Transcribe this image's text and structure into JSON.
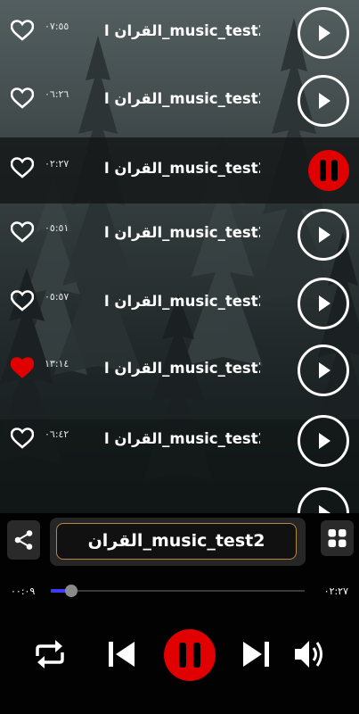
{
  "tracks": [
    {
      "title": "القران ا_music_test2",
      "duration": "٠٧:٥٥",
      "favorite": false,
      "state": "idle"
    },
    {
      "title": "القران ا_music_test2",
      "duration": "٠٦:٢٦",
      "favorite": false,
      "state": "idle"
    },
    {
      "title": "القران ا_music_test2",
      "duration": "٠٢:٢٧",
      "favorite": false,
      "state": "playing"
    },
    {
      "title": "القران ا_music_test2",
      "duration": "٠٥:٥١",
      "favorite": false,
      "state": "idle"
    },
    {
      "title": "القران ا_music_test2",
      "duration": "٠٥:٥٧",
      "favorite": false,
      "state": "idle"
    },
    {
      "title": "القران ا_music_test2",
      "duration": "١٣:١٤",
      "favorite": true,
      "state": "idle"
    },
    {
      "title": "القران ا_music_test2",
      "duration": "٠٦:٤٢",
      "favorite": false,
      "state": "idle"
    }
  ],
  "player": {
    "now_playing_title": "القران_music_test2",
    "time_elapsed": "٠٠:٠٩",
    "time_total": "٠٢:٢٧",
    "progress_fraction": 0.06,
    "is_playing": true
  },
  "icons": {
    "share": "share-icon",
    "grid": "grid-icon",
    "repeat": "repeat-icon",
    "previous": "skip-previous-icon",
    "pause": "pause-icon",
    "next": "skip-next-icon",
    "volume": "volume-icon",
    "play": "play-icon",
    "heart": "heart-icon"
  },
  "colors": {
    "accent_red": "#e00000",
    "favorite_red": "#e00000",
    "seek_blue": "#3b3bff",
    "title_border_gold": "#b2873e"
  }
}
